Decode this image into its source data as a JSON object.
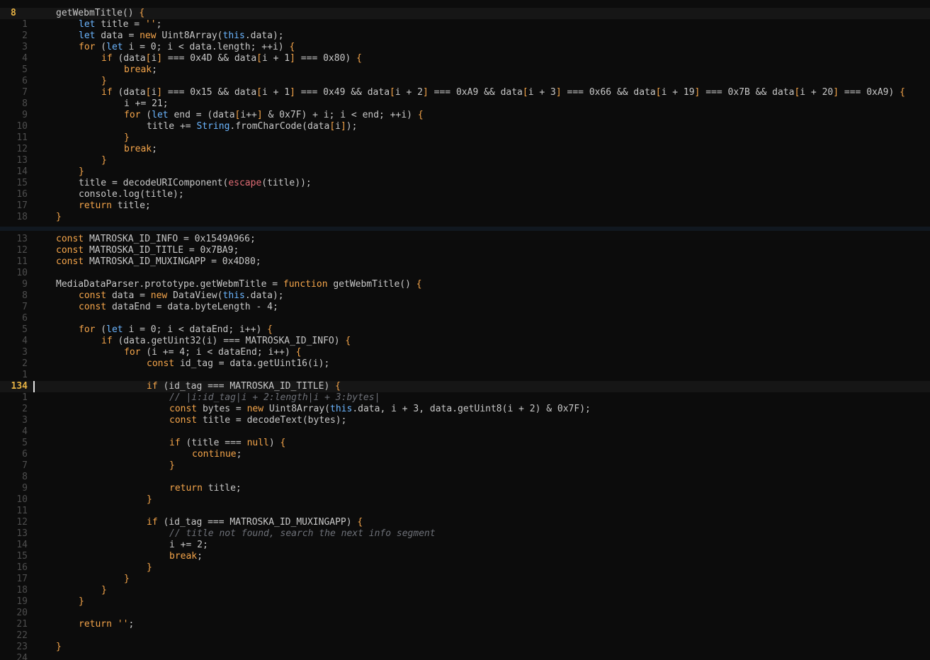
{
  "editor": {
    "top_pane": {
      "current_line": "8",
      "lines": [
        {
          "n": "8",
          "current": true,
          "indent": 1,
          "tokens": [
            {
              "t": "getWebmTitle() "
            },
            {
              "t": "{",
              "c": "br"
            }
          ]
        },
        {
          "n": "1",
          "indent": 2,
          "tokens": [
            {
              "t": "let",
              "c": "kw2"
            },
            {
              "t": " title = "
            },
            {
              "t": "''",
              "c": "str"
            },
            {
              "t": ";"
            }
          ]
        },
        {
          "n": "2",
          "indent": 2,
          "tokens": [
            {
              "t": "let",
              "c": "kw2"
            },
            {
              "t": " data = "
            },
            {
              "t": "new",
              "c": "kw"
            },
            {
              "t": " Uint8Array("
            },
            {
              "t": "this",
              "c": "kw2"
            },
            {
              "t": ".data);"
            }
          ]
        },
        {
          "n": "3",
          "indent": 2,
          "tokens": [
            {
              "t": "for",
              "c": "kw"
            },
            {
              "t": " ("
            },
            {
              "t": "let",
              "c": "kw2"
            },
            {
              "t": " i = 0; i < data.length; ++i) "
            },
            {
              "t": "{",
              "c": "br"
            }
          ]
        },
        {
          "n": "4",
          "indent": 3,
          "tokens": [
            {
              "t": "if",
              "c": "kw"
            },
            {
              "t": " (data"
            },
            {
              "t": "[",
              "c": "br"
            },
            {
              "t": "i"
            },
            {
              "t": "]",
              "c": "br"
            },
            {
              "t": " === 0x4D && data"
            },
            {
              "t": "[",
              "c": "br"
            },
            {
              "t": "i + 1"
            },
            {
              "t": "]",
              "c": "br"
            },
            {
              "t": " === 0x80) "
            },
            {
              "t": "{",
              "c": "br"
            }
          ]
        },
        {
          "n": "5",
          "indent": 4,
          "tokens": [
            {
              "t": "break",
              "c": "kw"
            },
            {
              "t": ";"
            }
          ]
        },
        {
          "n": "6",
          "indent": 3,
          "tokens": [
            {
              "t": "}",
              "c": "br"
            }
          ]
        },
        {
          "n": "7",
          "indent": 3,
          "tokens": [
            {
              "t": "if",
              "c": "kw"
            },
            {
              "t": " (data"
            },
            {
              "t": "[",
              "c": "br"
            },
            {
              "t": "i"
            },
            {
              "t": "]",
              "c": "br"
            },
            {
              "t": " === 0x15 && data"
            },
            {
              "t": "[",
              "c": "br"
            },
            {
              "t": "i + 1"
            },
            {
              "t": "]",
              "c": "br"
            },
            {
              "t": " === 0x49 && data"
            },
            {
              "t": "[",
              "c": "br"
            },
            {
              "t": "i + 2"
            },
            {
              "t": "]",
              "c": "br"
            },
            {
              "t": " === 0xA9 && data"
            },
            {
              "t": "[",
              "c": "br"
            },
            {
              "t": "i + 3"
            },
            {
              "t": "]",
              "c": "br"
            },
            {
              "t": " === 0x66 && data"
            },
            {
              "t": "[",
              "c": "br"
            },
            {
              "t": "i + 19"
            },
            {
              "t": "]",
              "c": "br"
            },
            {
              "t": " === 0x7B && data"
            },
            {
              "t": "[",
              "c": "br"
            },
            {
              "t": "i + 20"
            },
            {
              "t": "]",
              "c": "br"
            },
            {
              "t": " === 0xA9) "
            },
            {
              "t": "{",
              "c": "br"
            }
          ]
        },
        {
          "n": "8",
          "indent": 4,
          "tokens": [
            {
              "t": "i += 21;"
            }
          ]
        },
        {
          "n": "9",
          "indent": 4,
          "tokens": [
            {
              "t": "for",
              "c": "kw"
            },
            {
              "t": " ("
            },
            {
              "t": "let",
              "c": "kw2"
            },
            {
              "t": " end = (data"
            },
            {
              "t": "[",
              "c": "br"
            },
            {
              "t": "i++"
            },
            {
              "t": "]",
              "c": "br"
            },
            {
              "t": " & 0x7F) + i; i < end; ++i) "
            },
            {
              "t": "{",
              "c": "br"
            }
          ]
        },
        {
          "n": "10",
          "indent": 5,
          "tokens": [
            {
              "t": "title += "
            },
            {
              "t": "String",
              "c": "cls"
            },
            {
              "t": ".fromCharCode(data"
            },
            {
              "t": "[",
              "c": "br"
            },
            {
              "t": "i"
            },
            {
              "t": "]",
              "c": "br"
            },
            {
              "t": ");"
            }
          ]
        },
        {
          "n": "11",
          "indent": 4,
          "tokens": [
            {
              "t": "}",
              "c": "br"
            }
          ]
        },
        {
          "n": "12",
          "indent": 4,
          "tokens": [
            {
              "t": "break",
              "c": "kw"
            },
            {
              "t": ";"
            }
          ]
        },
        {
          "n": "13",
          "indent": 3,
          "tokens": [
            {
              "t": "}",
              "c": "br"
            }
          ]
        },
        {
          "n": "14",
          "indent": 2,
          "tokens": [
            {
              "t": "}",
              "c": "br"
            }
          ]
        },
        {
          "n": "15",
          "indent": 2,
          "tokens": [
            {
              "t": "title = decodeURIComponent("
            },
            {
              "t": "escape",
              "c": "fn"
            },
            {
              "t": "(title));"
            }
          ]
        },
        {
          "n": "16",
          "indent": 2,
          "tokens": [
            {
              "t": "console.log(title);"
            }
          ]
        },
        {
          "n": "17",
          "indent": 2,
          "tokens": [
            {
              "t": "return",
              "c": "kw"
            },
            {
              "t": " title;"
            }
          ]
        },
        {
          "n": "18",
          "indent": 1,
          "tokens": [
            {
              "t": "}",
              "c": "br"
            }
          ]
        }
      ]
    },
    "bottom_pane": {
      "current_line": "134",
      "lines": [
        {
          "n": "13",
          "indent": 1,
          "tokens": [
            {
              "t": "const",
              "c": "kw"
            },
            {
              "t": " MATROSKA_ID_INFO = 0x1549A966;"
            }
          ]
        },
        {
          "n": "12",
          "indent": 1,
          "tokens": [
            {
              "t": "const",
              "c": "kw"
            },
            {
              "t": " MATROSKA_ID_TITLE = 0x7BA9;"
            }
          ]
        },
        {
          "n": "11",
          "indent": 1,
          "tokens": [
            {
              "t": "const",
              "c": "kw"
            },
            {
              "t": " MATROSKA_ID_MUXINGAPP = 0x4D80;"
            }
          ]
        },
        {
          "n": "10",
          "indent": 0,
          "tokens": []
        },
        {
          "n": "9",
          "indent": 1,
          "tokens": [
            {
              "t": "MediaDataParser.prototype.getWebmTitle = "
            },
            {
              "t": "function",
              "c": "kw"
            },
            {
              "t": " getWebmTitle() "
            },
            {
              "t": "{",
              "c": "br"
            }
          ]
        },
        {
          "n": "8",
          "indent": 2,
          "tokens": [
            {
              "t": "const",
              "c": "kw"
            },
            {
              "t": " data = "
            },
            {
              "t": "new",
              "c": "kw"
            },
            {
              "t": " DataView("
            },
            {
              "t": "this",
              "c": "kw2"
            },
            {
              "t": ".data);"
            }
          ]
        },
        {
          "n": "7",
          "indent": 2,
          "tokens": [
            {
              "t": "const",
              "c": "kw"
            },
            {
              "t": " dataEnd = data.byteLength - 4;"
            }
          ]
        },
        {
          "n": "6",
          "indent": 0,
          "tokens": []
        },
        {
          "n": "5",
          "indent": 2,
          "tokens": [
            {
              "t": "for",
              "c": "kw"
            },
            {
              "t": " ("
            },
            {
              "t": "let",
              "c": "kw2"
            },
            {
              "t": " i = 0; i < dataEnd; i++) "
            },
            {
              "t": "{",
              "c": "br"
            }
          ]
        },
        {
          "n": "4",
          "indent": 3,
          "tokens": [
            {
              "t": "if",
              "c": "kw"
            },
            {
              "t": " (data.getUint32(i) === MATROSKA_ID_INFO) "
            },
            {
              "t": "{",
              "c": "br"
            }
          ]
        },
        {
          "n": "3",
          "indent": 4,
          "tokens": [
            {
              "t": "for",
              "c": "kw"
            },
            {
              "t": " (i += 4; i < dataEnd; i++) "
            },
            {
              "t": "{",
              "c": "br"
            }
          ]
        },
        {
          "n": "2",
          "indent": 5,
          "tokens": [
            {
              "t": "const",
              "c": "kw"
            },
            {
              "t": " id_tag = data.getUint16(i);"
            }
          ]
        },
        {
          "n": "1",
          "indent": 0,
          "tokens": []
        },
        {
          "n": "134",
          "current": true,
          "indent": 5,
          "tokens": [
            {
              "t": "if",
              "c": "kw"
            },
            {
              "t": " (id_tag === MATROSKA_ID_TITLE) "
            },
            {
              "t": "{",
              "c": "br"
            }
          ]
        },
        {
          "n": "1",
          "indent": 6,
          "tokens": [
            {
              "t": "// |i:id_tag|i + 2:length|i + 3:bytes|",
              "c": "com"
            }
          ]
        },
        {
          "n": "2",
          "indent": 6,
          "tokens": [
            {
              "t": "const",
              "c": "kw"
            },
            {
              "t": " bytes = "
            },
            {
              "t": "new",
              "c": "kw"
            },
            {
              "t": " Uint8Array("
            },
            {
              "t": "this",
              "c": "kw2"
            },
            {
              "t": ".data, i + 3, data.getUint8(i + 2) & 0x7F);"
            }
          ]
        },
        {
          "n": "3",
          "indent": 6,
          "tokens": [
            {
              "t": "const",
              "c": "kw"
            },
            {
              "t": " title = decodeText(bytes);"
            }
          ]
        },
        {
          "n": "4",
          "indent": 0,
          "tokens": []
        },
        {
          "n": "5",
          "indent": 6,
          "tokens": [
            {
              "t": "if",
              "c": "kw"
            },
            {
              "t": " (title === "
            },
            {
              "t": "null",
              "c": "kw"
            },
            {
              "t": ") "
            },
            {
              "t": "{",
              "c": "br"
            }
          ]
        },
        {
          "n": "6",
          "indent": 7,
          "tokens": [
            {
              "t": "continue",
              "c": "kw"
            },
            {
              "t": ";"
            }
          ]
        },
        {
          "n": "7",
          "indent": 6,
          "tokens": [
            {
              "t": "}",
              "c": "br"
            }
          ]
        },
        {
          "n": "8",
          "indent": 0,
          "tokens": []
        },
        {
          "n": "9",
          "indent": 6,
          "tokens": [
            {
              "t": "return",
              "c": "kw"
            },
            {
              "t": " title;"
            }
          ]
        },
        {
          "n": "10",
          "indent": 5,
          "tokens": [
            {
              "t": "}",
              "c": "br"
            }
          ]
        },
        {
          "n": "11",
          "indent": 0,
          "tokens": []
        },
        {
          "n": "12",
          "indent": 5,
          "tokens": [
            {
              "t": "if",
              "c": "kw"
            },
            {
              "t": " (id_tag === MATROSKA_ID_MUXINGAPP) "
            },
            {
              "t": "{",
              "c": "br"
            }
          ]
        },
        {
          "n": "13",
          "indent": 6,
          "tokens": [
            {
              "t": "// title not found, search the next info segment",
              "c": "com"
            }
          ]
        },
        {
          "n": "14",
          "indent": 6,
          "tokens": [
            {
              "t": "i += 2;"
            }
          ]
        },
        {
          "n": "15",
          "indent": 6,
          "tokens": [
            {
              "t": "break",
              "c": "kw"
            },
            {
              "t": ";"
            }
          ]
        },
        {
          "n": "16",
          "indent": 5,
          "tokens": [
            {
              "t": "}",
              "c": "br"
            }
          ]
        },
        {
          "n": "17",
          "indent": 4,
          "tokens": [
            {
              "t": "}",
              "c": "br"
            }
          ]
        },
        {
          "n": "18",
          "indent": 3,
          "tokens": [
            {
              "t": "}",
              "c": "br"
            }
          ]
        },
        {
          "n": "19",
          "indent": 2,
          "tokens": [
            {
              "t": "}",
              "c": "br"
            }
          ]
        },
        {
          "n": "20",
          "indent": 0,
          "tokens": []
        },
        {
          "n": "21",
          "indent": 2,
          "tokens": [
            {
              "t": "return",
              "c": "kw"
            },
            {
              "t": " "
            },
            {
              "t": "''",
              "c": "str"
            },
            {
              "t": ";"
            }
          ]
        },
        {
          "n": "22",
          "indent": 0,
          "tokens": []
        },
        {
          "n": "23",
          "indent": 1,
          "tokens": [
            {
              "t": "}",
              "c": "br"
            }
          ]
        },
        {
          "n": "24",
          "indent": 0,
          "tokens": []
        }
      ]
    }
  },
  "colors": {
    "background": "#0c0c0c",
    "current_line": "#161616",
    "line_number": "#4e4e4e",
    "current_line_number": "#e5b143",
    "keyword": "#f5a54a",
    "builtin": "#6cb6ff",
    "function_call": "#e06c75",
    "comment": "#6e7178",
    "text": "#c8c8c8"
  }
}
